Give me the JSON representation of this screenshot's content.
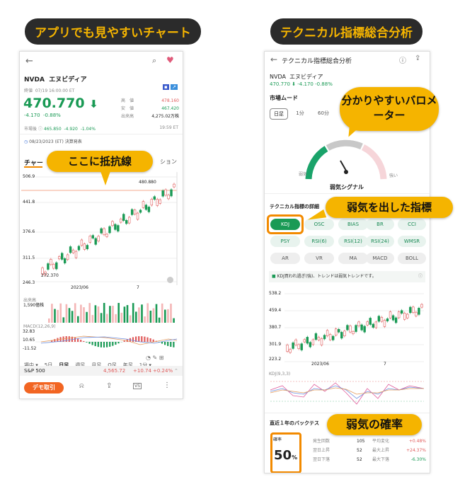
{
  "headers": {
    "left": "アプリでも見やすいチャート",
    "right": "テクニカル指標総合分析"
  },
  "left": {
    "ticker": "NVDA",
    "name": "エヌビディア",
    "close_label": "終値",
    "datetime": "07/19 16:00:00 ET",
    "price": "470.770",
    "change": "-4.170",
    "change_pct": "-0.88%",
    "high_label": "高　値",
    "high": "478.160",
    "low_label": "安　値",
    "low": "467.420",
    "volume_label": "出来高",
    "volume": "4,275.02万株",
    "premarket_label": "市場後",
    "premarket_price": "465.850",
    "premarket_change": "-4.920",
    "premarket_pct": "-1.04%",
    "premarket_time": "19:59 ET",
    "earnings": "08/23/2023 (ET)  決算発表",
    "chart_tab": "チャー",
    "option_tab": "ション",
    "y_ticks": [
      "506.9",
      "441.8",
      "376.6",
      "311.5",
      "246.3"
    ],
    "high_marker": "480.880",
    "low_marker": "272.370",
    "x_label": "2023/06",
    "x_label2": "7",
    "volume_title": "出来高",
    "volume_value": "1,590億株",
    "macd_ticks": [
      "32.83",
      "10.65",
      "-11.52"
    ],
    "macd_label": "MACD(12,26,9)",
    "period_tabs": [
      "場中",
      "5日",
      "日足",
      "週足",
      "月足",
      "Q足",
      "年足",
      "1分"
    ],
    "index_name": "S&P 500",
    "index_value": "4,565.72",
    "index_change": "+10.74",
    "index_pct": "+0.24%",
    "trade_button": "デモ取引",
    "callout": "ここに抵抗線"
  },
  "right": {
    "title": "テクニカル指標総合分析",
    "ticker": "NVDA",
    "name": "エヌビディア",
    "price": "470.770",
    "change": "-4.170",
    "change_pct": "-0.88%",
    "mood_title": "市場ムード",
    "periods": [
      "日足",
      "1分",
      "60分"
    ],
    "gauge_left": "弱気",
    "gauge_right": "強い",
    "gauge_result": "弱気シグナル",
    "detail_title": "テクニカル指標の詳細",
    "chips": [
      "KDJ",
      "OSC",
      "BIAS",
      "BR",
      "CCI",
      "PSY",
      "RSI(6)",
      "RSI(12)",
      "RSI(24)",
      "WMSR",
      "AR",
      "VR",
      "MA",
      "MACD",
      "BOLL"
    ],
    "kdj_note": "KDJ買われ過ぎ(強)、トレンドは弱気トレンドです。",
    "y_ticks": [
      "538.2",
      "459.4",
      "380.7",
      "301.9",
      "223.2"
    ],
    "x_label": "2023/06",
    "x_label2": "7",
    "kdj_label": "KDJ(9,3,3)",
    "backtest_title": "直近１年のバックテス",
    "prob_label": "確率",
    "prob_value": "50",
    "prob_unit": "%",
    "stats": [
      {
        "label": "発生回数",
        "value": "105",
        "label2": "平均変化",
        "value2": "+0.48%"
      },
      {
        "label": "翌日上昇",
        "value": "52",
        "label2": "最大上昇",
        "value2": "+24.37%"
      },
      {
        "label": "翌日下落",
        "value": "52",
        "label2": "最大下落",
        "value2": "-6.30%"
      }
    ],
    "callout_gauge": "分かりやすいバロメーター",
    "callout_signal": "弱気を出した指標",
    "callout_prob": "弱気の確率"
  },
  "colors": {
    "accent": "#f5b400",
    "up": "#e05a5a",
    "down": "#1a9a55"
  }
}
